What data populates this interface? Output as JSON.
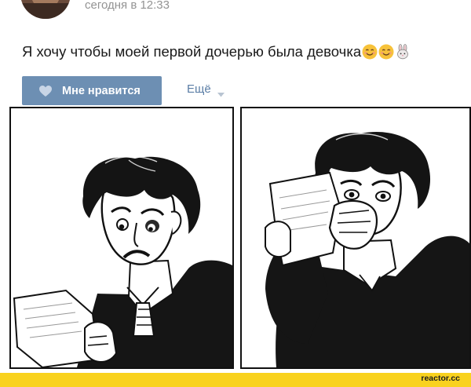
{
  "post": {
    "timestamp": "сегодня в 12:33",
    "text": "Я хочу чтобы моей первой дочерью была девочка",
    "emojis": [
      "smiling-face-icon",
      "smiling-face-icon",
      "rabbit-icon"
    ]
  },
  "actions": {
    "like_label": "Мне нравится",
    "more_label": "Ещё"
  },
  "colors": {
    "like_button": "#6d8fb3",
    "link": "#5b7ea6",
    "footer": "#f9d21e"
  },
  "watermark": "reactor.cc"
}
